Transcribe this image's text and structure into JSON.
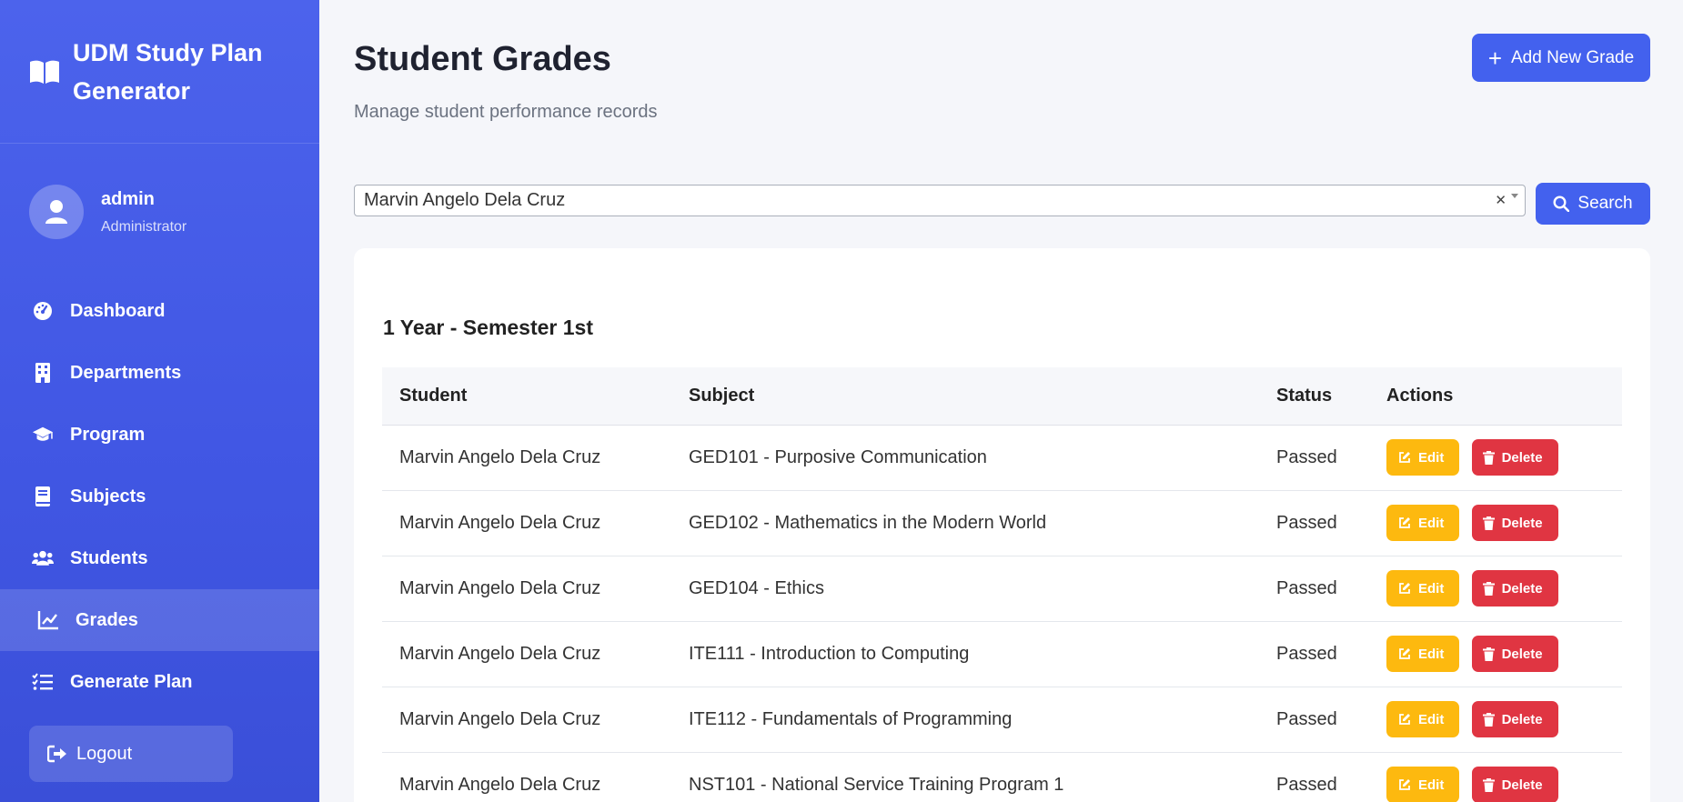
{
  "sidebar": {
    "brand_title": "UDM Study Plan Generator",
    "user": {
      "name": "admin",
      "role": "Administrator"
    },
    "nav": [
      {
        "label": "Dashboard",
        "icon": "gauge-icon"
      },
      {
        "label": "Departments",
        "icon": "building-icon"
      },
      {
        "label": "Program",
        "icon": "graduation-cap-icon"
      },
      {
        "label": "Subjects",
        "icon": "book-icon"
      },
      {
        "label": "Students",
        "icon": "users-icon"
      },
      {
        "label": "Grades",
        "icon": "chart-line-icon",
        "active": true
      },
      {
        "label": "Generate Plan",
        "icon": "list-check-icon"
      }
    ],
    "logout_label": "Logout"
  },
  "header": {
    "title": "Student Grades",
    "subtitle": "Manage student performance records",
    "add_button_label": "Add New Grade"
  },
  "search": {
    "selected_student": "Marvin Angelo Dela Cruz",
    "button_label": "Search"
  },
  "grades": {
    "section_title": "1 Year - Semester 1st",
    "columns": [
      "Student",
      "Subject",
      "Status",
      "Actions"
    ],
    "edit_label": "Edit",
    "delete_label": "Delete",
    "rows": [
      {
        "student": "Marvin Angelo Dela Cruz",
        "subject": "GED101 - Purposive Communication",
        "status": "Passed"
      },
      {
        "student": "Marvin Angelo Dela Cruz",
        "subject": "GED102 - Mathematics in the Modern World",
        "status": "Passed"
      },
      {
        "student": "Marvin Angelo Dela Cruz",
        "subject": "GED104 - Ethics",
        "status": "Passed"
      },
      {
        "student": "Marvin Angelo Dela Cruz",
        "subject": "ITE111 - Introduction to Computing",
        "status": "Passed"
      },
      {
        "student": "Marvin Angelo Dela Cruz",
        "subject": "ITE112 - Fundamentals of Programming",
        "status": "Passed"
      },
      {
        "student": "Marvin Angelo Dela Cruz",
        "subject": "NST101 - National Service Training Program 1",
        "status": "Passed"
      }
    ]
  },
  "colors": {
    "primary": "#4361ee",
    "sidebar": "#4157e4",
    "edit": "#fdb90f",
    "delete": "#e03542"
  }
}
